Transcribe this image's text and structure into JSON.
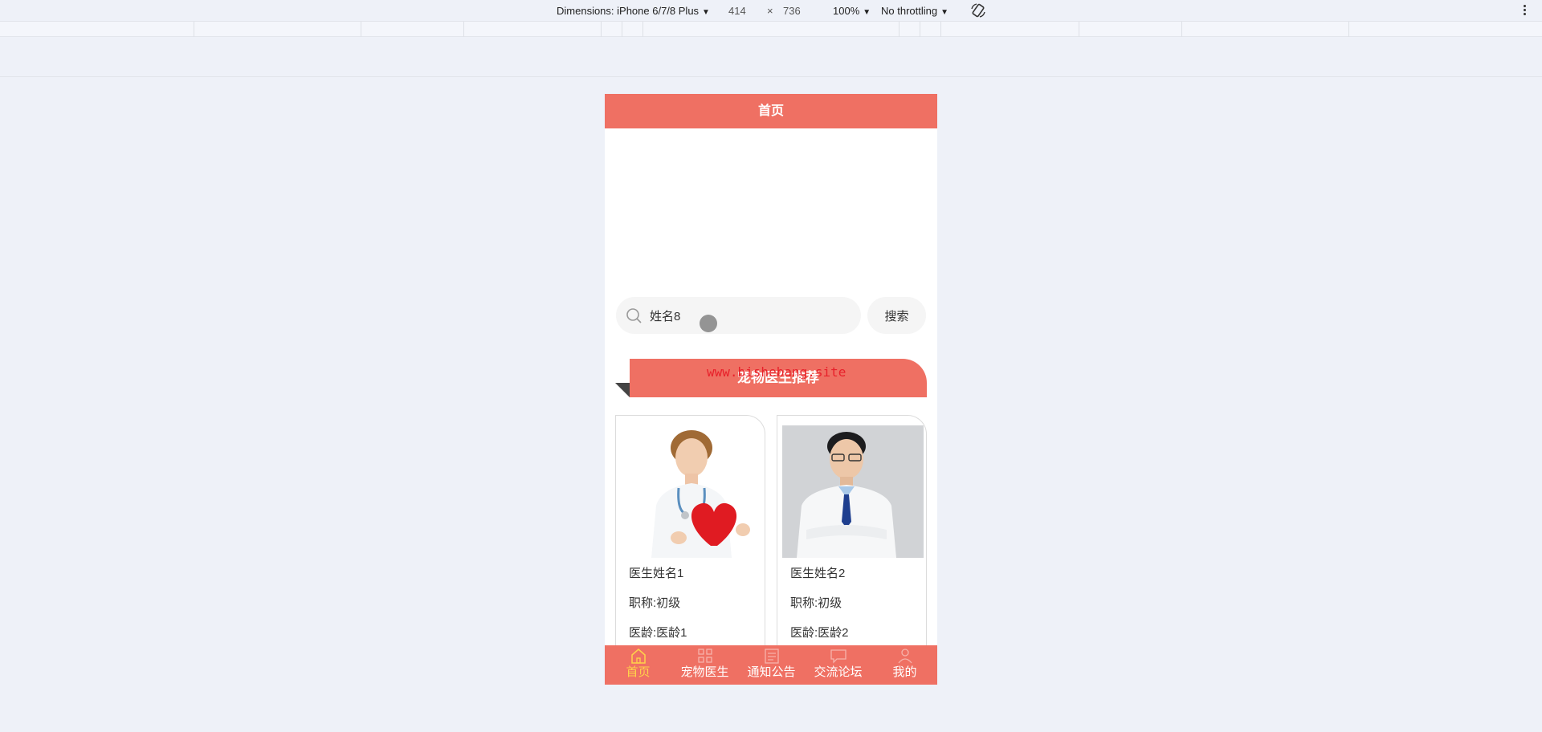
{
  "devtools": {
    "dimensions_label": "Dimensions: iPhone 6/7/8 Plus",
    "width": "414",
    "times": "×",
    "height": "736",
    "zoom": "100%",
    "throttling": "No throttling"
  },
  "app": {
    "nav_title": "首页",
    "search": {
      "value": "姓名8",
      "button": "搜索"
    },
    "section_title": "宠物医生推荐",
    "watermark": "www.bishebang.site",
    "doctors": [
      {
        "name": "医生姓名1",
        "title": "职称:初级",
        "age": "医龄:医龄1"
      },
      {
        "name": "医生姓名2",
        "title": "职称:初级",
        "age": "医龄:医龄2"
      }
    ],
    "tabs": [
      {
        "label": "首页",
        "icon": "home-icon",
        "active": true
      },
      {
        "label": "宠物医生",
        "icon": "grid-icon",
        "active": false
      },
      {
        "label": "通知公告",
        "icon": "news-icon",
        "active": false
      },
      {
        "label": "交流论坛",
        "icon": "chat-icon",
        "active": false
      },
      {
        "label": "我的",
        "icon": "user-icon",
        "active": false
      }
    ],
    "colors": {
      "primary": "#ef7063",
      "active_tab": "#ffd24a"
    }
  }
}
